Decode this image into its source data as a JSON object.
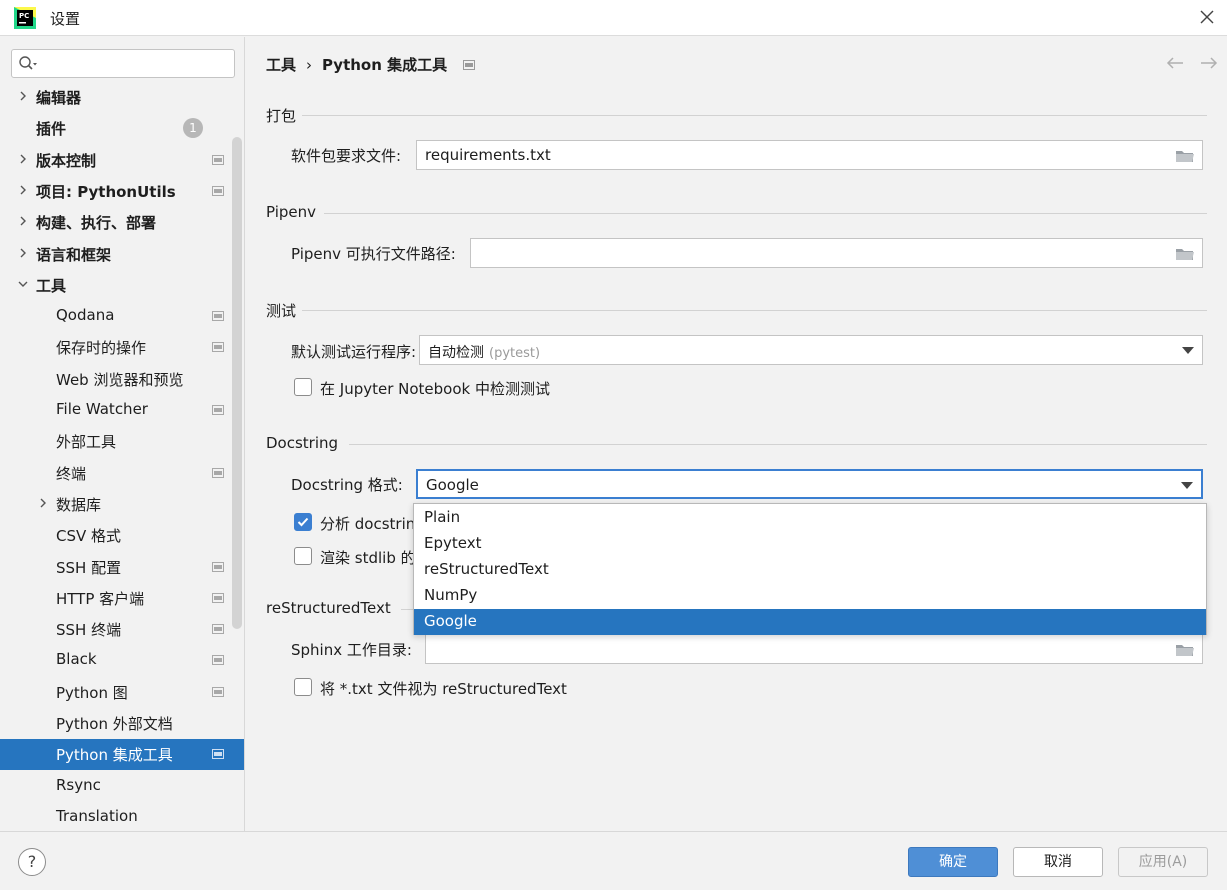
{
  "window": {
    "title": "设置"
  },
  "colors": {
    "accent": "#2675bf",
    "primary_button": "#4f8fd6",
    "focus_border": "#3b7fd1"
  },
  "sidebar": {
    "search_placeholder": "",
    "plugins_badge": "1",
    "items": [
      {
        "label": "编辑器",
        "bold": true,
        "expandable": true
      },
      {
        "label": "插件",
        "bold": true,
        "expandable": false
      },
      {
        "label": "版本控制",
        "bold": true,
        "expandable": true
      },
      {
        "label": "项目: PythonUtils",
        "bold": true,
        "expandable": true
      },
      {
        "label": "构建、执行、部署",
        "bold": true,
        "expandable": true
      },
      {
        "label": "语言和框架",
        "bold": true,
        "expandable": true
      },
      {
        "label": "工具",
        "bold": true,
        "expandable": true,
        "expanded": true
      },
      {
        "label": "Qodana"
      },
      {
        "label": "保存时的操作"
      },
      {
        "label": "Web 浏览器和预览"
      },
      {
        "label": "File Watcher"
      },
      {
        "label": "外部工具"
      },
      {
        "label": "终端"
      },
      {
        "label": "数据库",
        "expandable": true
      },
      {
        "label": "CSV 格式"
      },
      {
        "label": "SSH 配置"
      },
      {
        "label": "HTTP 客户端"
      },
      {
        "label": "SSH 终端"
      },
      {
        "label": "Black"
      },
      {
        "label": "Python 图"
      },
      {
        "label": "Python 外部文档"
      },
      {
        "label": "Python 集成工具",
        "selected": true
      },
      {
        "label": "Rsync"
      },
      {
        "label": "Translation"
      }
    ]
  },
  "breadcrumb": {
    "parent": "工具",
    "separator": "›",
    "current": "Python 集成工具"
  },
  "sections": {
    "packaging": {
      "title": "打包",
      "req_label": "软件包要求文件:",
      "req_value": "requirements.txt"
    },
    "pipenv": {
      "title": "Pipenv",
      "path_label": "Pipenv 可执行文件路径:",
      "path_value": ""
    },
    "testing": {
      "title": "测试",
      "runner_label": "默认测试运行程序:",
      "runner_value": "自动检测",
      "runner_hint": "(pytest)",
      "jupyter_checkbox": "在 Jupyter Notebook 中检测测试",
      "jupyter_checked": false
    },
    "docstring": {
      "title": "Docstring",
      "format_label": "Docstring 格式:",
      "format_value": "Google",
      "analyze_checkbox": "分析 docstrin",
      "analyze_checked": true,
      "render_checkbox": "渲染 stdlib 的",
      "render_checked": false
    },
    "rst": {
      "title": "reStructuredText",
      "sphinx_label": "Sphinx 工作目录:",
      "sphinx_value": "",
      "txt_checkbox": "将 *.txt 文件视为 reStructuredText",
      "txt_checked": false
    }
  },
  "dropdown": {
    "options": [
      "Plain",
      "Epytext",
      "reStructuredText",
      "NumPy",
      "Google"
    ],
    "selected": "Google"
  },
  "footer": {
    "help": "?",
    "ok": "确定",
    "cancel": "取消",
    "apply": "应用(A)"
  }
}
